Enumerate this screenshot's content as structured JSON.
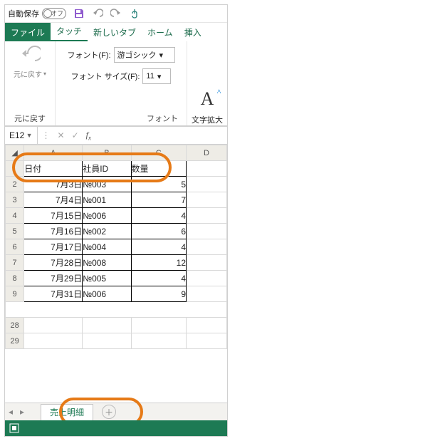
{
  "qat": {
    "autosave_label": "自動保存",
    "autosave_state": "オフ"
  },
  "tabs": {
    "file": "ファイル",
    "touch": "タッチ",
    "newtab": "新しいタブ",
    "home": "ホーム",
    "insert": "挿入"
  },
  "ribbon": {
    "undo_label": "元に戻す",
    "undo_group": "元に戻す",
    "font_label": "フォント(F):",
    "font_value": "游ゴシック",
    "fontsize_label": "フォント サイズ(F):",
    "fontsize_value": "11",
    "font_group": "フォント",
    "enlarge_label": "文字拡大"
  },
  "namebox": "E12",
  "columns": [
    "A",
    "B",
    "C",
    "D"
  ],
  "headers": {
    "a": "日付",
    "b": "社員ID",
    "c": "数量"
  },
  "rows": [
    {
      "n": "2",
      "a": "7月3日",
      "b": "№003",
      "c": "5"
    },
    {
      "n": "3",
      "a": "7月4日",
      "b": "№001",
      "c": "7"
    },
    {
      "n": "4",
      "a": "7月15日",
      "b": "№006",
      "c": "4"
    },
    {
      "n": "5",
      "a": "7月16日",
      "b": "№002",
      "c": "6"
    },
    {
      "n": "6",
      "a": "7月17日",
      "b": "№004",
      "c": "4"
    },
    {
      "n": "7",
      "a": "7月28日",
      "b": "№008",
      "c": "12"
    },
    {
      "n": "8",
      "a": "7月29日",
      "b": "№005",
      "c": "4"
    },
    {
      "n": "9",
      "a": "7月31日",
      "b": "№006",
      "c": "9"
    }
  ],
  "extra_rows": [
    "28",
    "29"
  ],
  "sheet_tab": "売上明細"
}
